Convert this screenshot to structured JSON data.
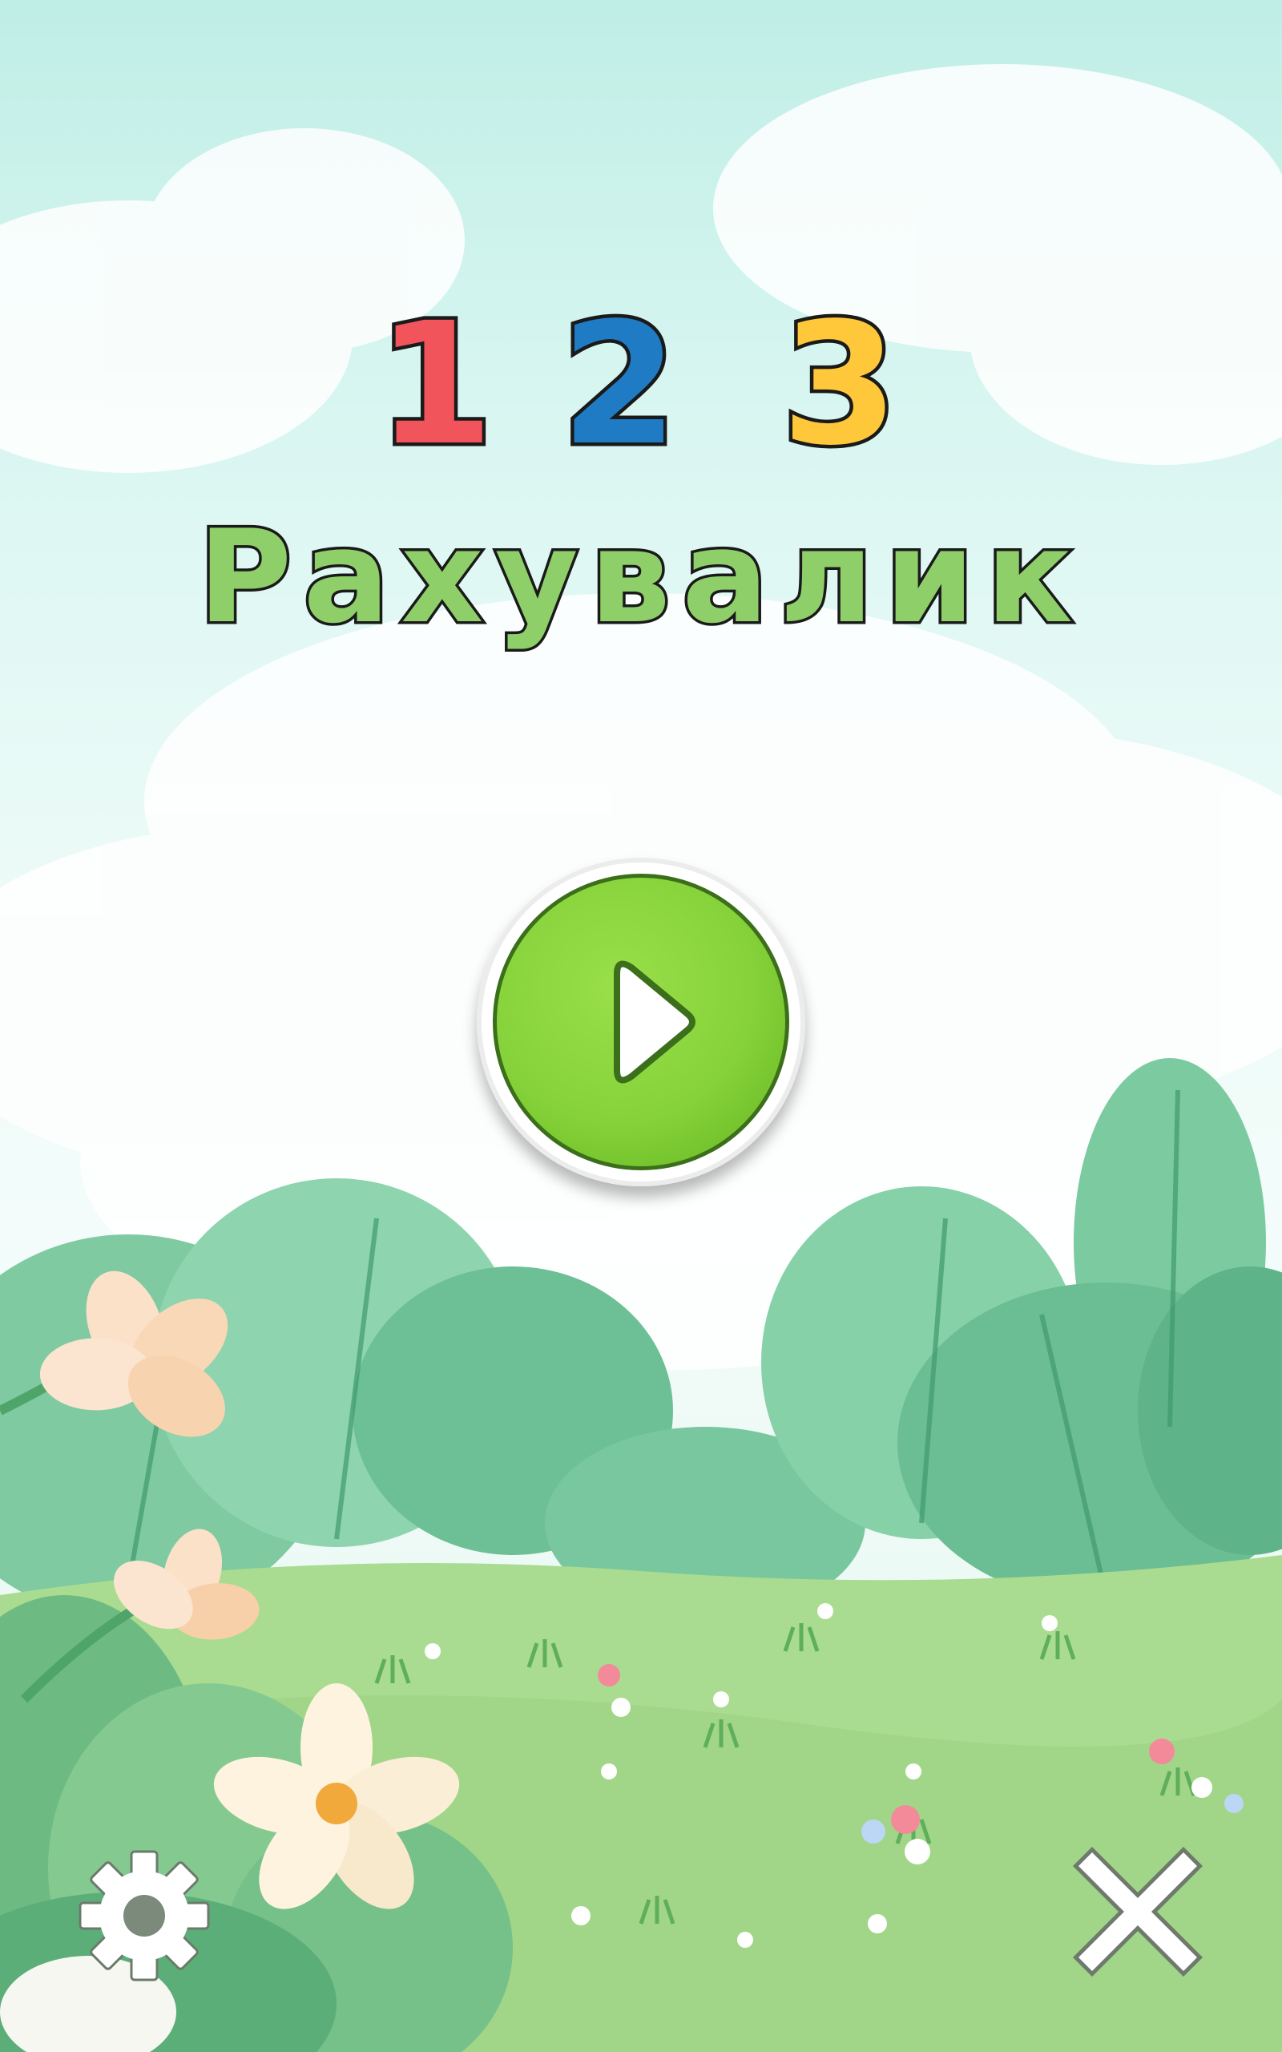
{
  "game": {
    "logo_digits": [
      "1",
      "2",
      "3"
    ],
    "title": "Рахувалик"
  },
  "controls": {
    "play_icon": "play-triangle-icon",
    "settings_icon": "gear-icon",
    "close_icon": "close-x-icon"
  },
  "colors": {
    "digit_1": "#f2545b",
    "digit_2": "#1f7cc4",
    "digit_3": "#ffc83a",
    "title_green": "#8fcf6a",
    "play_green": "#86d23a"
  }
}
